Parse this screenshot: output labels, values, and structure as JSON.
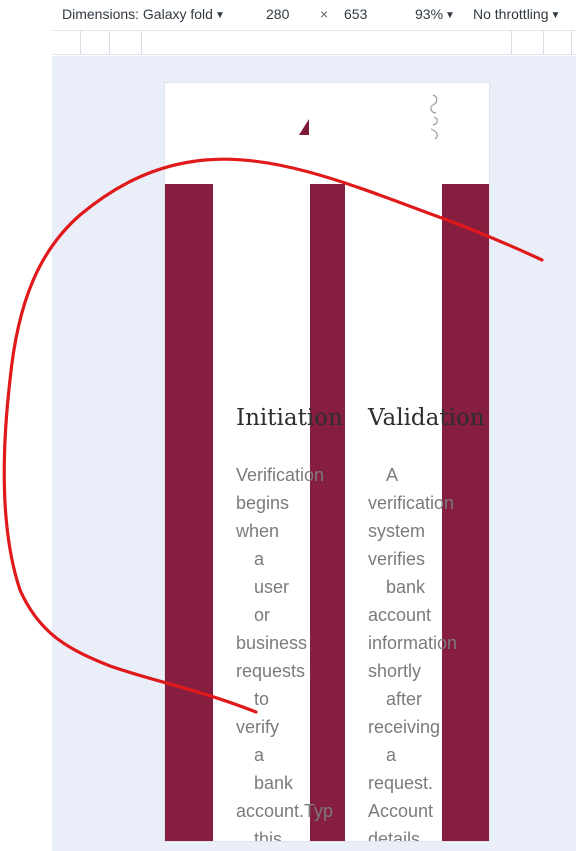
{
  "devtools": {
    "dimensions_label": "Dimensions: Galaxy fold",
    "width": "280",
    "times": "×",
    "height": "653",
    "zoom": "93%",
    "throttling": "No throttling"
  },
  "cards": [
    {
      "title": "Initiation",
      "lines": [
        "Verification",
        "begins",
        "when",
        "a",
        "user",
        "or",
        "business",
        "requests",
        "to",
        "verify",
        "a",
        "bank",
        "account.Typ",
        "this"
      ],
      "aligns": [
        "l",
        "l",
        "l",
        "c",
        "c",
        "c",
        "l",
        "l",
        "c",
        "l",
        "c",
        "c",
        "l",
        "c"
      ]
    },
    {
      "title": "Validation",
      "lines": [
        "A",
        "verification",
        "system",
        "verifies",
        "bank",
        "account",
        "information",
        "shortly",
        "after",
        "receiving",
        "a",
        "request.",
        "Account",
        "details"
      ],
      "aligns": [
        "c",
        "l",
        "l",
        "l",
        "c",
        "l",
        "l",
        "l",
        "c",
        "l",
        "c",
        "l",
        "l",
        "l"
      ]
    }
  ],
  "colors": {
    "accent": "#861e40",
    "annotation_stroke": "#e0191b"
  },
  "icons": {
    "logo": "triangle-logo-icon",
    "deco": "doodle-icon"
  }
}
